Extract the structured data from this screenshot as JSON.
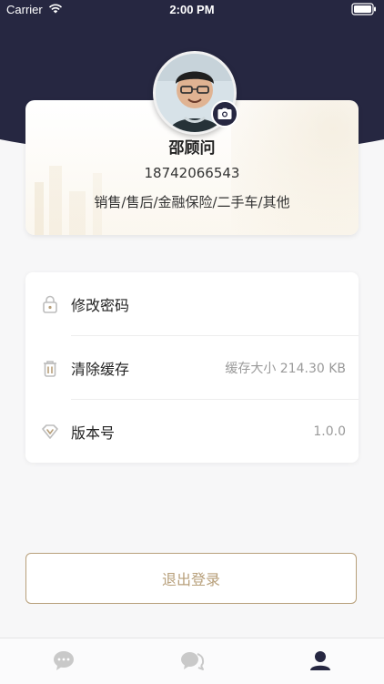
{
  "status_bar": {
    "carrier": "Carrier",
    "time": "2:00 PM"
  },
  "profile": {
    "name": "邵顾问",
    "phone": "18742066543",
    "roles": "销售/售后/金融保险/二手车/其他",
    "avatar_icon": "avatar-photo",
    "camera_icon": "camera-icon"
  },
  "settings": {
    "items": [
      {
        "label": "修改密码",
        "value": "",
        "icon": "lock-icon"
      },
      {
        "label": "清除缓存",
        "value": "缓存大小 214.30 KB",
        "icon": "trash-icon"
      },
      {
        "label": "版本号",
        "value": "1.0.0",
        "icon": "diamond-icon"
      }
    ]
  },
  "logout": {
    "label": "退出登录"
  },
  "tab_bar": {
    "tabs": [
      {
        "icon": "chat-bubble-icon",
        "active": false
      },
      {
        "icon": "chat-bubbles-icon",
        "active": false
      },
      {
        "icon": "profile-icon",
        "active": true
      }
    ]
  },
  "colors": {
    "header_bg": "#262741",
    "accent_gold": "#b79f7a",
    "tab_active": "#262741",
    "tab_inactive": "#c9c9c9"
  }
}
